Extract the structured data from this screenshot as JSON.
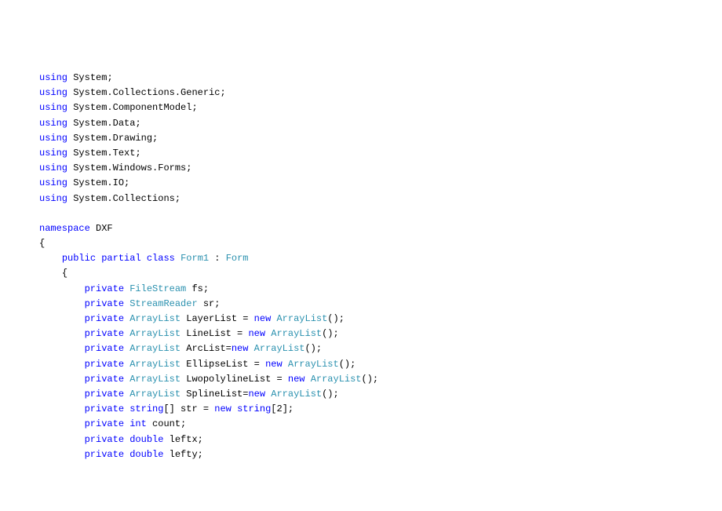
{
  "code": {
    "usings": [
      "System",
      "System.Collections.Generic",
      "System.ComponentModel",
      "System.Data",
      "System.Drawing",
      "System.Text",
      "System.Windows.Forms",
      "System.IO",
      "System.Collections"
    ],
    "namespace_kw": "namespace",
    "namespace_name": " DXF",
    "lbrace": "{",
    "rbrace": "}",
    "indent1": "    ",
    "indent2": "        ",
    "public_kw": "public",
    "partial_kw": "partial",
    "class_kw": "class",
    "class_name": "Form1",
    "colon": " : ",
    "base_class": "Form",
    "private_kw": "private",
    "using_kw": "using",
    "semicolon": ";",
    "new_kw": "new",
    "int_kw": "int",
    "double_kw": "double",
    "string_kw": "string",
    "filestream_type": "FileStream",
    "streamreader_type": "StreamReader",
    "arraylist_type": "ArrayList",
    "fs_var": " fs;",
    "sr_var": " sr;",
    "layerlist": " LayerList = ",
    "linelist": " LineList = ",
    "arclist": " ArcList=",
    "ellipselist": " EllipseList = ",
    "lwopolylinelist": " LwopolylineList = ",
    "splinelist": " SplineList=",
    "arraylist_ctor": "ArrayList",
    "ctor_call": "();",
    "str_decl": "[] str = ",
    "str_ctor": "string",
    "str_size": "[2];",
    "count_var": " count;",
    "leftx_var": " leftx;",
    "lefty_var": " lefty;",
    "space": " "
  }
}
